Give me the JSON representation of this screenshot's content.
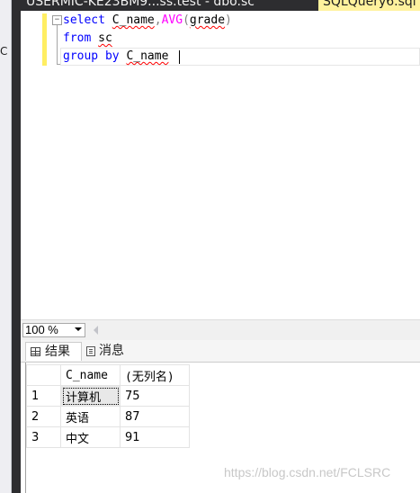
{
  "left_panel": {
    "fragment": "C"
  },
  "tabs": {
    "query_tab": "USERMIC-KE23BM9...ss.test - dbo.sc",
    "active_tab": "SQLQuery6.sql"
  },
  "editor": {
    "collapse_symbol": "−",
    "line1": {
      "kw": "select",
      "col1": "C_name",
      "comma": ",",
      "fn": "AVG",
      "lp": "(",
      "arg": "grade",
      "rp": ")"
    },
    "line2": {
      "kw": "from",
      "table": "sc"
    },
    "line3": {
      "kw1": "group",
      "kw2": "by",
      "col": "C_name"
    }
  },
  "zoom": {
    "value": "100 %"
  },
  "result_tabs": {
    "results": "结果",
    "messages": "消息"
  },
  "results": {
    "columns": [
      "C_name",
      "(无列名)"
    ],
    "rows": [
      {
        "index": "1",
        "name": "计算机",
        "value": "75"
      },
      {
        "index": "2",
        "name": "英语",
        "value": "87"
      },
      {
        "index": "3",
        "name": "中文",
        "value": "91"
      }
    ]
  },
  "watermark": "https://blog.csdn.net/FCLSRC",
  "colors": {
    "keyword": "#0000ff",
    "function": "#ff00ff",
    "tab_active": "#fff29d",
    "dark_chrome": "#2d2d30"
  }
}
